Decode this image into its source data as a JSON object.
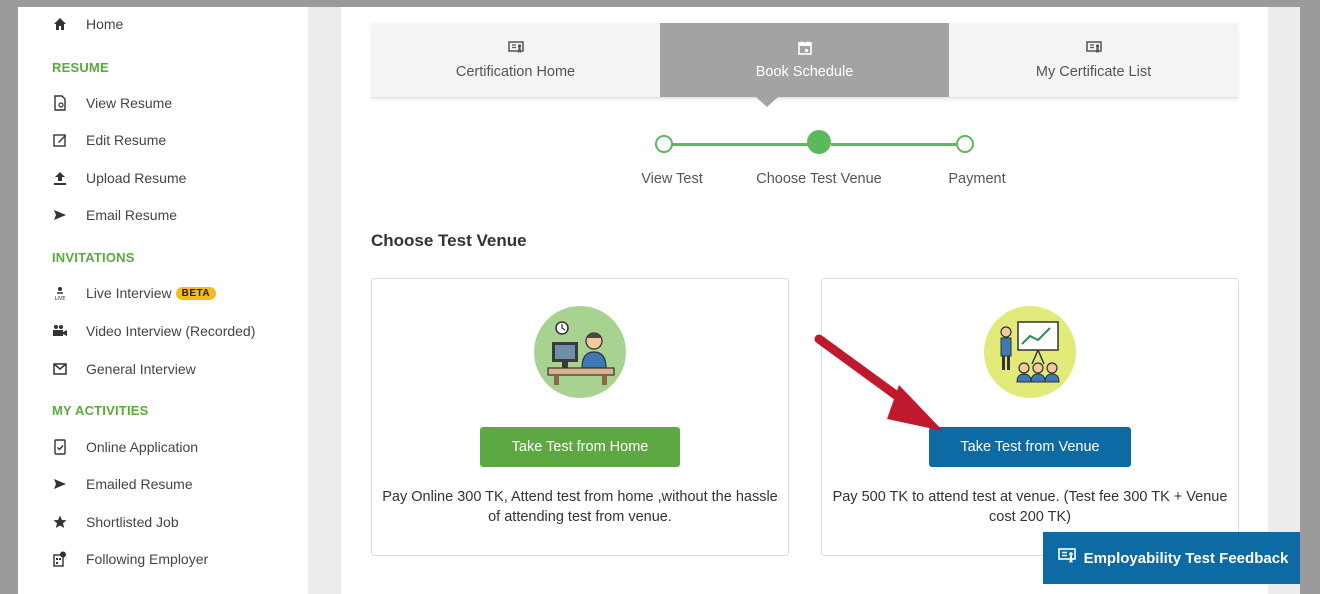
{
  "sidebar": {
    "home": {
      "label": "Home",
      "icon": "home-icon"
    },
    "sections": [
      {
        "title": "RESUME"
      },
      {
        "title": "INVITATIONS"
      },
      {
        "title": "MY ACTIVITIES"
      }
    ],
    "resume_items": [
      {
        "label": "View Resume",
        "icon": "view-resume-icon"
      },
      {
        "label": "Edit Resume",
        "icon": "edit-icon"
      },
      {
        "label": "Upload Resume",
        "icon": "upload-icon"
      },
      {
        "label": "Email Resume",
        "icon": "send-icon"
      }
    ],
    "invitation_items": [
      {
        "label": "Live Interview",
        "icon": "live-icon",
        "badge": "BETA"
      },
      {
        "label": "Video Interview (Recorded)",
        "icon": "video-camera-icon"
      },
      {
        "label": "General Interview",
        "icon": "envelope-icon"
      }
    ],
    "activity_items": [
      {
        "label": "Online Application",
        "icon": "application-icon"
      },
      {
        "label": "Emailed Resume",
        "icon": "send-icon"
      },
      {
        "label": "Shortlisted Job",
        "icon": "star-icon"
      },
      {
        "label": "Following Employer",
        "icon": "employer-icon"
      }
    ]
  },
  "tabs": [
    {
      "label": "Certification Home",
      "icon": "certificate-icon",
      "active": false
    },
    {
      "label": "Book Schedule",
      "icon": "calendar-icon",
      "active": true
    },
    {
      "label": "My Certificate List",
      "icon": "certificate-icon",
      "active": false
    }
  ],
  "stepper": {
    "steps": [
      {
        "label": "View Test",
        "state": "done"
      },
      {
        "label": "Choose Test Venue",
        "state": "current"
      },
      {
        "label": "Payment",
        "state": "pending"
      }
    ]
  },
  "main": {
    "section_title": "Choose Test Venue",
    "cards": [
      {
        "button_label": "Take Test from Home",
        "button_color": "#5ea843",
        "circle_color": "#a8d28f",
        "illustration": "person-at-computer-icon",
        "description": "Pay Online 300 TK, Attend test from home ,without the hassle of attending test from venue."
      },
      {
        "button_label": "Take Test from Venue",
        "button_color": "#0e6aa3",
        "circle_color": "#e2ea7a",
        "illustration": "presentation-audience-icon",
        "description": "Pay 500 TK to attend test at venue. (Test fee 300 TK + Venue cost 200 TK)"
      }
    ]
  },
  "annotation": {
    "arrow_color": "#c0182c"
  },
  "feedback_button": {
    "label": "Employability Test Feedback",
    "icon": "feedback-icon"
  }
}
